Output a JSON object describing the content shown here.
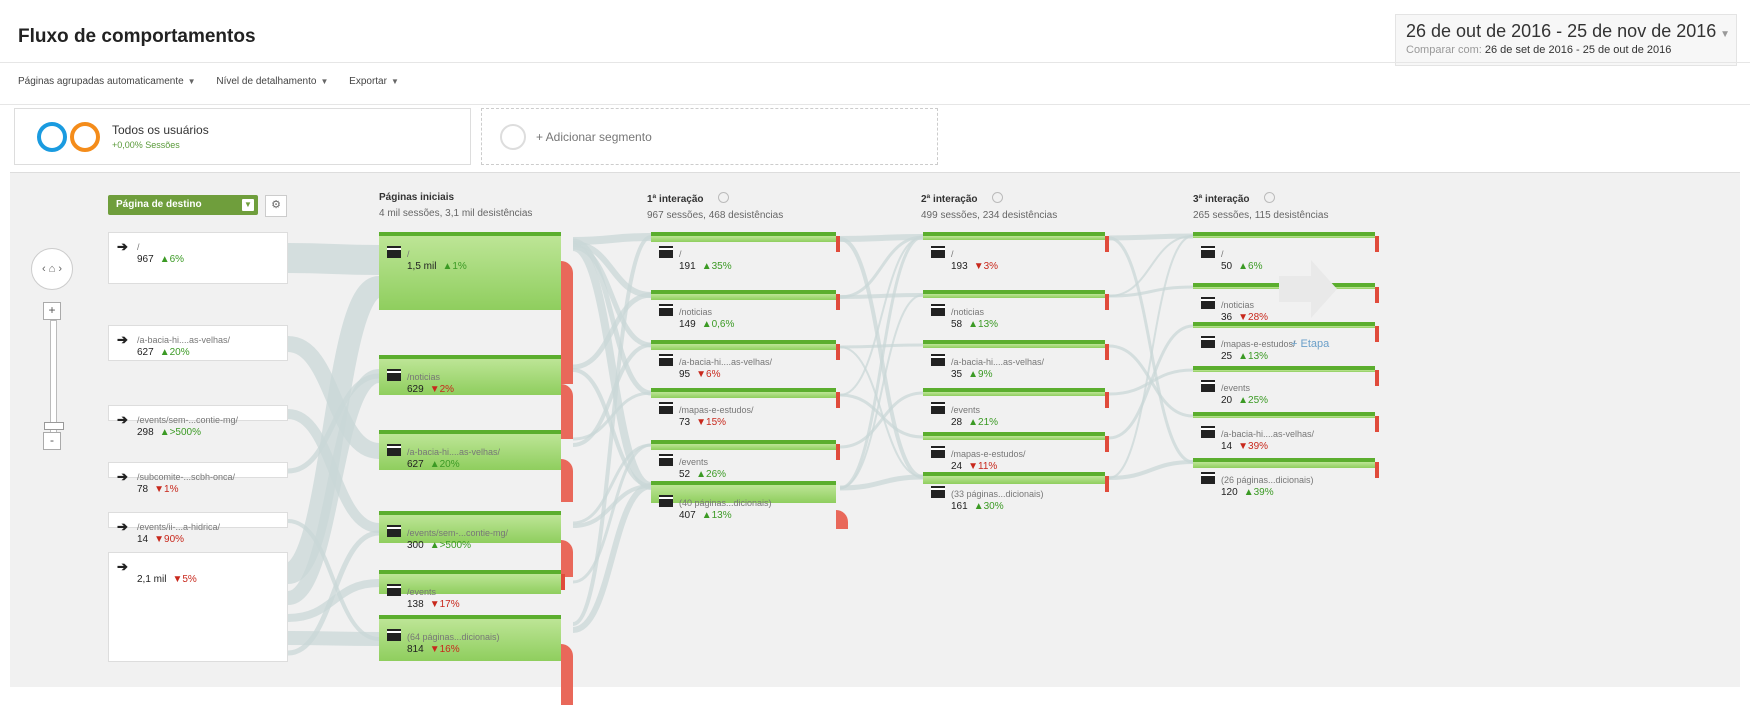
{
  "header": {
    "title": "Fluxo de comportamentos",
    "date_range": "26 de out de 2016 - 25 de nov de 2016",
    "compare_label": "Comparar com:",
    "compare_range": "26 de set de 2016 - 25 de out de 2016"
  },
  "toolbar": {
    "grouping": "Páginas agrupadas automaticamente",
    "detail": "Nível de detalhamento",
    "export": "Exportar"
  },
  "segments": {
    "active_name": "Todos os usuários",
    "active_sub": "+0,00% Sessões",
    "add_label": "+ Adicionar segmento"
  },
  "colors": {
    "accent_green": "#6f9e3c",
    "page_green": "#8fce5e",
    "drop_red": "#e9685a",
    "up": "#3b9a24",
    "down": "#c8281c"
  },
  "dimension": {
    "label": "Página de destino"
  },
  "columns": [
    {
      "title": "Páginas iniciais",
      "stats": "4 mil sessões, 3,1 mil desistências"
    },
    {
      "title": "1ª interação",
      "stats": "967 sessões, 468 desistências"
    },
    {
      "title": "2ª interação",
      "stats": "499 sessões, 234 desistências"
    },
    {
      "title": "3ª interação",
      "stats": "265 sessões, 115 desistências"
    }
  ],
  "sources": [
    {
      "name": "/",
      "value": "967",
      "change": "6%",
      "dir": "up"
    },
    {
      "name": "/a-bacia-hi....as-velhas/",
      "value": "627",
      "change": "20%",
      "dir": "up"
    },
    {
      "name": "/events/sem-...contie-mg/",
      "value": "298",
      "change": ">500%",
      "dir": "up"
    },
    {
      "name": "/subcomite-...scbh-onca/",
      "value": "78",
      "change": "1%",
      "dir": "down"
    },
    {
      "name": "/events/ii-...a-hidrica/",
      "value": "14",
      "change": "90%",
      "dir": "down"
    },
    {
      "name": "",
      "value": "2,1 mil",
      "change": "5%",
      "dir": "down"
    }
  ],
  "starting_pages": [
    {
      "name": "/",
      "value": "1,5 mil",
      "change": "1%",
      "dir": "up"
    },
    {
      "name": "/noticias",
      "value": "629",
      "change": "2%",
      "dir": "down"
    },
    {
      "name": "/a-bacia-hi....as-velhas/",
      "value": "627",
      "change": "20%",
      "dir": "up"
    },
    {
      "name": "/events/sem-...contie-mg/",
      "value": "300",
      "change": ">500%",
      "dir": "up"
    },
    {
      "name": "/events",
      "value": "138",
      "change": "17%",
      "dir": "down"
    },
    {
      "name": "(64 páginas...dicionais)",
      "value": "814",
      "change": "16%",
      "dir": "down"
    }
  ],
  "interaction1": [
    {
      "name": "/",
      "value": "191",
      "change": "35%",
      "dir": "up"
    },
    {
      "name": "/noticias",
      "value": "149",
      "change": "0,6%",
      "dir": "up"
    },
    {
      "name": "/a-bacia-hi....as-velhas/",
      "value": "95",
      "change": "6%",
      "dir": "down"
    },
    {
      "name": "/mapas-e-estudos/",
      "value": "73",
      "change": "15%",
      "dir": "down"
    },
    {
      "name": "/events",
      "value": "52",
      "change": "26%",
      "dir": "up"
    },
    {
      "name": "(40 páginas...dicionais)",
      "value": "407",
      "change": "13%",
      "dir": "up"
    }
  ],
  "interaction2": [
    {
      "name": "/",
      "value": "193",
      "change": "3%",
      "dir": "down"
    },
    {
      "name": "/noticias",
      "value": "58",
      "change": "13%",
      "dir": "up"
    },
    {
      "name": "/a-bacia-hi....as-velhas/",
      "value": "35",
      "change": "9%",
      "dir": "up"
    },
    {
      "name": "/events",
      "value": "28",
      "change": "21%",
      "dir": "up"
    },
    {
      "name": "/mapas-e-estudos/",
      "value": "24",
      "change": "11%",
      "dir": "down"
    },
    {
      "name": "(33 páginas...dicionais)",
      "value": "161",
      "change": "30%",
      "dir": "up"
    }
  ],
  "interaction3": [
    {
      "name": "/",
      "value": "50",
      "change": "6%",
      "dir": "up"
    },
    {
      "name": "/noticias",
      "value": "36",
      "change": "28%",
      "dir": "down"
    },
    {
      "name": "/mapas-e-estudos/",
      "value": "25",
      "change": "13%",
      "dir": "up"
    },
    {
      "name": "/events",
      "value": "20",
      "change": "25%",
      "dir": "up"
    },
    {
      "name": "/a-bacia-hi....as-velhas/",
      "value": "14",
      "change": "39%",
      "dir": "down"
    },
    {
      "name": "(26 páginas...dicionais)",
      "value": "120",
      "change": "39%",
      "dir": "up"
    }
  ],
  "add_step": "+ Etapa"
}
